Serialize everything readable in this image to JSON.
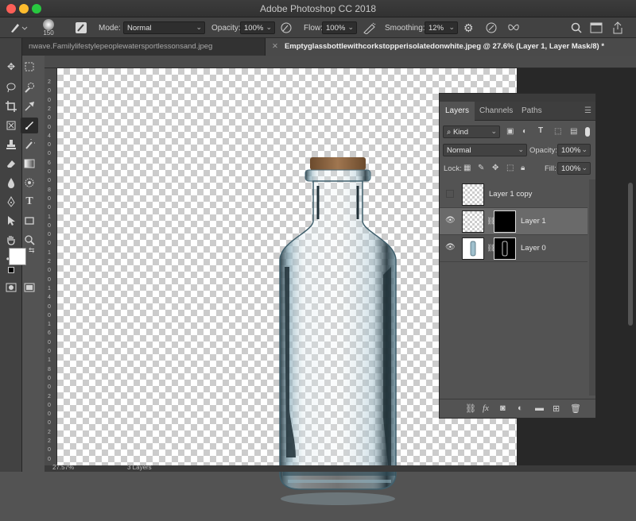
{
  "window": {
    "title": "Adobe Photoshop CC 2018"
  },
  "options_bar": {
    "brush_size": "150",
    "mode_label": "Mode:",
    "mode_value": "Normal",
    "opacity_label": "Opacity:",
    "opacity_value": "100%",
    "flow_label": "Flow:",
    "flow_value": "100%",
    "smoothing_label": "Smoothing:",
    "smoothing_value": "12%"
  },
  "tabs": [
    {
      "label": "nwave.Familylifestylepeoplewatersportlessonsand.jpeg"
    },
    {
      "label": "Emptyglassbottlewithcorkstopperisolatedonwhite.jpeg @ 27.6% (Layer 1, Layer Mask/8) *",
      "close": "✕"
    }
  ],
  "ruler": {
    "left_digits": [
      "2",
      "0",
      "0",
      "2",
      "0",
      "0",
      "4",
      "0",
      "0",
      "6",
      "0",
      "0",
      "8",
      "0",
      "0",
      "1",
      "0",
      "0",
      "0",
      "1",
      "2",
      "0",
      "0",
      "1",
      "4",
      "0",
      "0",
      "1",
      "6",
      "0",
      "0",
      "1",
      "8",
      "0",
      "0",
      "2",
      "0",
      "0",
      "0",
      "2",
      "2",
      "0",
      "0"
    ]
  },
  "status": {
    "zoom": "27.57%",
    "info": "3 Layers"
  },
  "layers_panel": {
    "tabs": [
      "Layers",
      "Channels",
      "Paths"
    ],
    "filter_kind": "Kind",
    "blend_mode": "Normal",
    "opacity_label": "Opacity:",
    "opacity_value": "100%",
    "lock_label": "Lock:",
    "fill_label": "Fill:",
    "fill_value": "100%",
    "layers": [
      {
        "name": "Layer 1 copy",
        "visible": false,
        "selected": false
      },
      {
        "name": "Layer 1",
        "visible": true,
        "selected": true
      },
      {
        "name": "Layer 0",
        "visible": true,
        "selected": false
      }
    ]
  },
  "colors": {
    "foreground": "#ffffff",
    "background": "#000000",
    "accent": "#6a6a6a"
  },
  "icons": {
    "toolbar": [
      "move-icon",
      "marquee-icon",
      "lasso-icon",
      "quick-select-icon",
      "crop-icon",
      "eyedropper-icon",
      "healing-icon",
      "brush-icon",
      "stamp-icon",
      "history-brush-icon",
      "eraser-icon",
      "gradient-icon",
      "blur-icon",
      "dodge-icon",
      "pen-icon",
      "type-icon",
      "path-select-icon",
      "shape-icon",
      "hand-icon",
      "zoom-icon"
    ]
  }
}
